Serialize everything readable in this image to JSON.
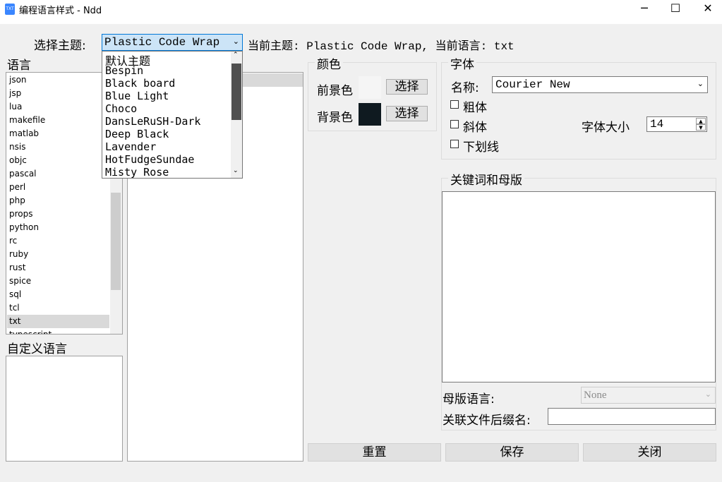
{
  "window": {
    "title": "编程语言样式 - Ndd",
    "minimize": "─",
    "maximize": "☐",
    "close": "✕"
  },
  "theme": {
    "label": "选择主题:",
    "selected": "Plastic Code Wrap",
    "current_info": "当前主题: Plastic Code Wrap, 当前语言: txt",
    "options": [
      "默认主题",
      "Bespin",
      "Black board",
      "Blue Light",
      "Choco",
      "DansLeRuSH-Dark",
      "Deep Black",
      "Lavender",
      "HotFudgeSundae",
      "Misty Rose"
    ]
  },
  "languages": {
    "label": "语言",
    "items": [
      "json",
      "jsp",
      "lua",
      "makefile",
      "matlab",
      "nsis",
      "objc",
      "pascal",
      "perl",
      "php",
      "props",
      "python",
      "rc",
      "ruby",
      "rust",
      "spice",
      "sql",
      "tcl",
      "txt",
      "typescript"
    ],
    "selected": "txt"
  },
  "custom_languages": {
    "label": "自定义语言"
  },
  "color": {
    "label": "颜色",
    "foreground_label": "前景色",
    "background_label": "背景色",
    "choose_label": "选择",
    "foreground_color": "#f5f5f5",
    "background_color": "#0f1a20"
  },
  "font": {
    "label": "字体",
    "name_label": "名称:",
    "name_value": "Courier New",
    "bold_label": "粗体",
    "italic_label": "斜体",
    "underline_label": "下划线",
    "size_label": "字体大小",
    "size_value": "14"
  },
  "keywords": {
    "label": "关键词和母版",
    "base_lang_label": "母版语言:",
    "base_lang_value": "None",
    "ext_label": "关联文件后缀名:"
  },
  "buttons": {
    "reset": "重置",
    "save": "保存",
    "close": "关闭"
  }
}
